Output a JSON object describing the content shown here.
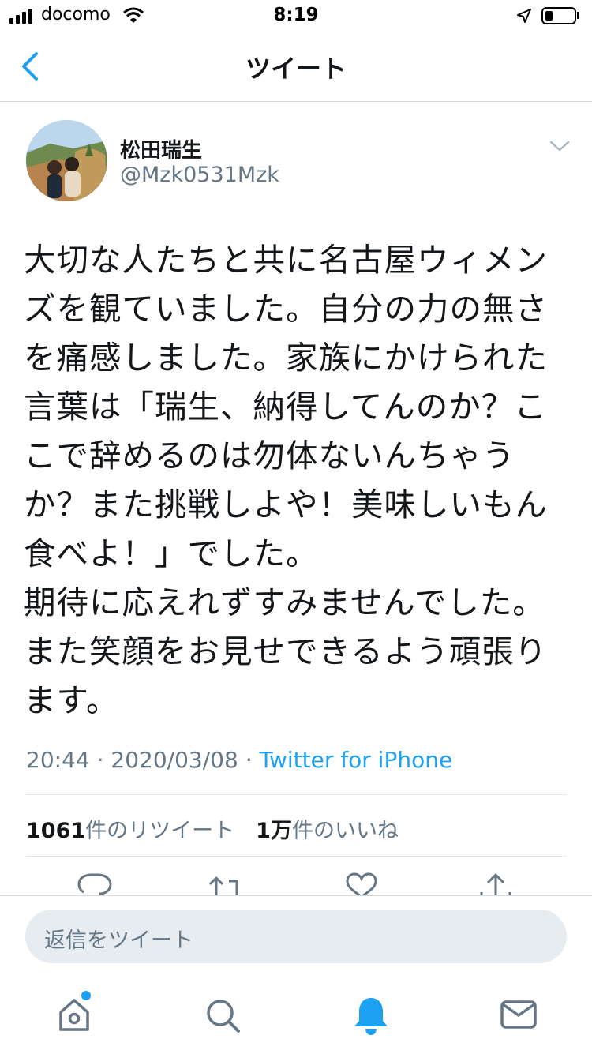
{
  "status_bar": {
    "carrier": "docomo",
    "time": "8:19",
    "battery_level": 0.25
  },
  "nav": {
    "title": "ツイート",
    "back_icon": "chevron-left-icon"
  },
  "tweet": {
    "display_name": "松田瑞生",
    "handle": "@Mzk0531Mzk",
    "text": "大切な人たちと共に名古屋ウィメンズを観ていました。自分の力の無さを痛感しました。家族にかけられた言葉は「瑞生、納得してんのか？ここで辞めるのは勿体ないんちゃうか？また挑戦しよや！美味しいもん食べよ！」でした。\n期待に応えれずすみませんでした。また笑顔をお見せできるよう頑張ります。",
    "time": "20:44",
    "date": "2020/03/08",
    "separator": "·",
    "source": "Twitter for iPhone",
    "retweet_count": "1061",
    "retweet_label": "件のリツイート",
    "like_count": "1万",
    "like_label": "件のいいね"
  },
  "actions": [
    "reply-icon",
    "retweet-icon",
    "like-icon",
    "share-icon"
  ],
  "reply": {
    "placeholder": "返信をツイート"
  },
  "tab_bar": {
    "items": [
      "home-icon",
      "search-icon",
      "notifications-icon",
      "messages-icon"
    ],
    "active": "notifications-icon",
    "home_has_badge": true
  },
  "colors": {
    "accent": "#1da1f2",
    "text": "#14171a",
    "secondary": "#657786",
    "divider": "#e1e8ed",
    "reply_bg": "#e6ecf0"
  }
}
